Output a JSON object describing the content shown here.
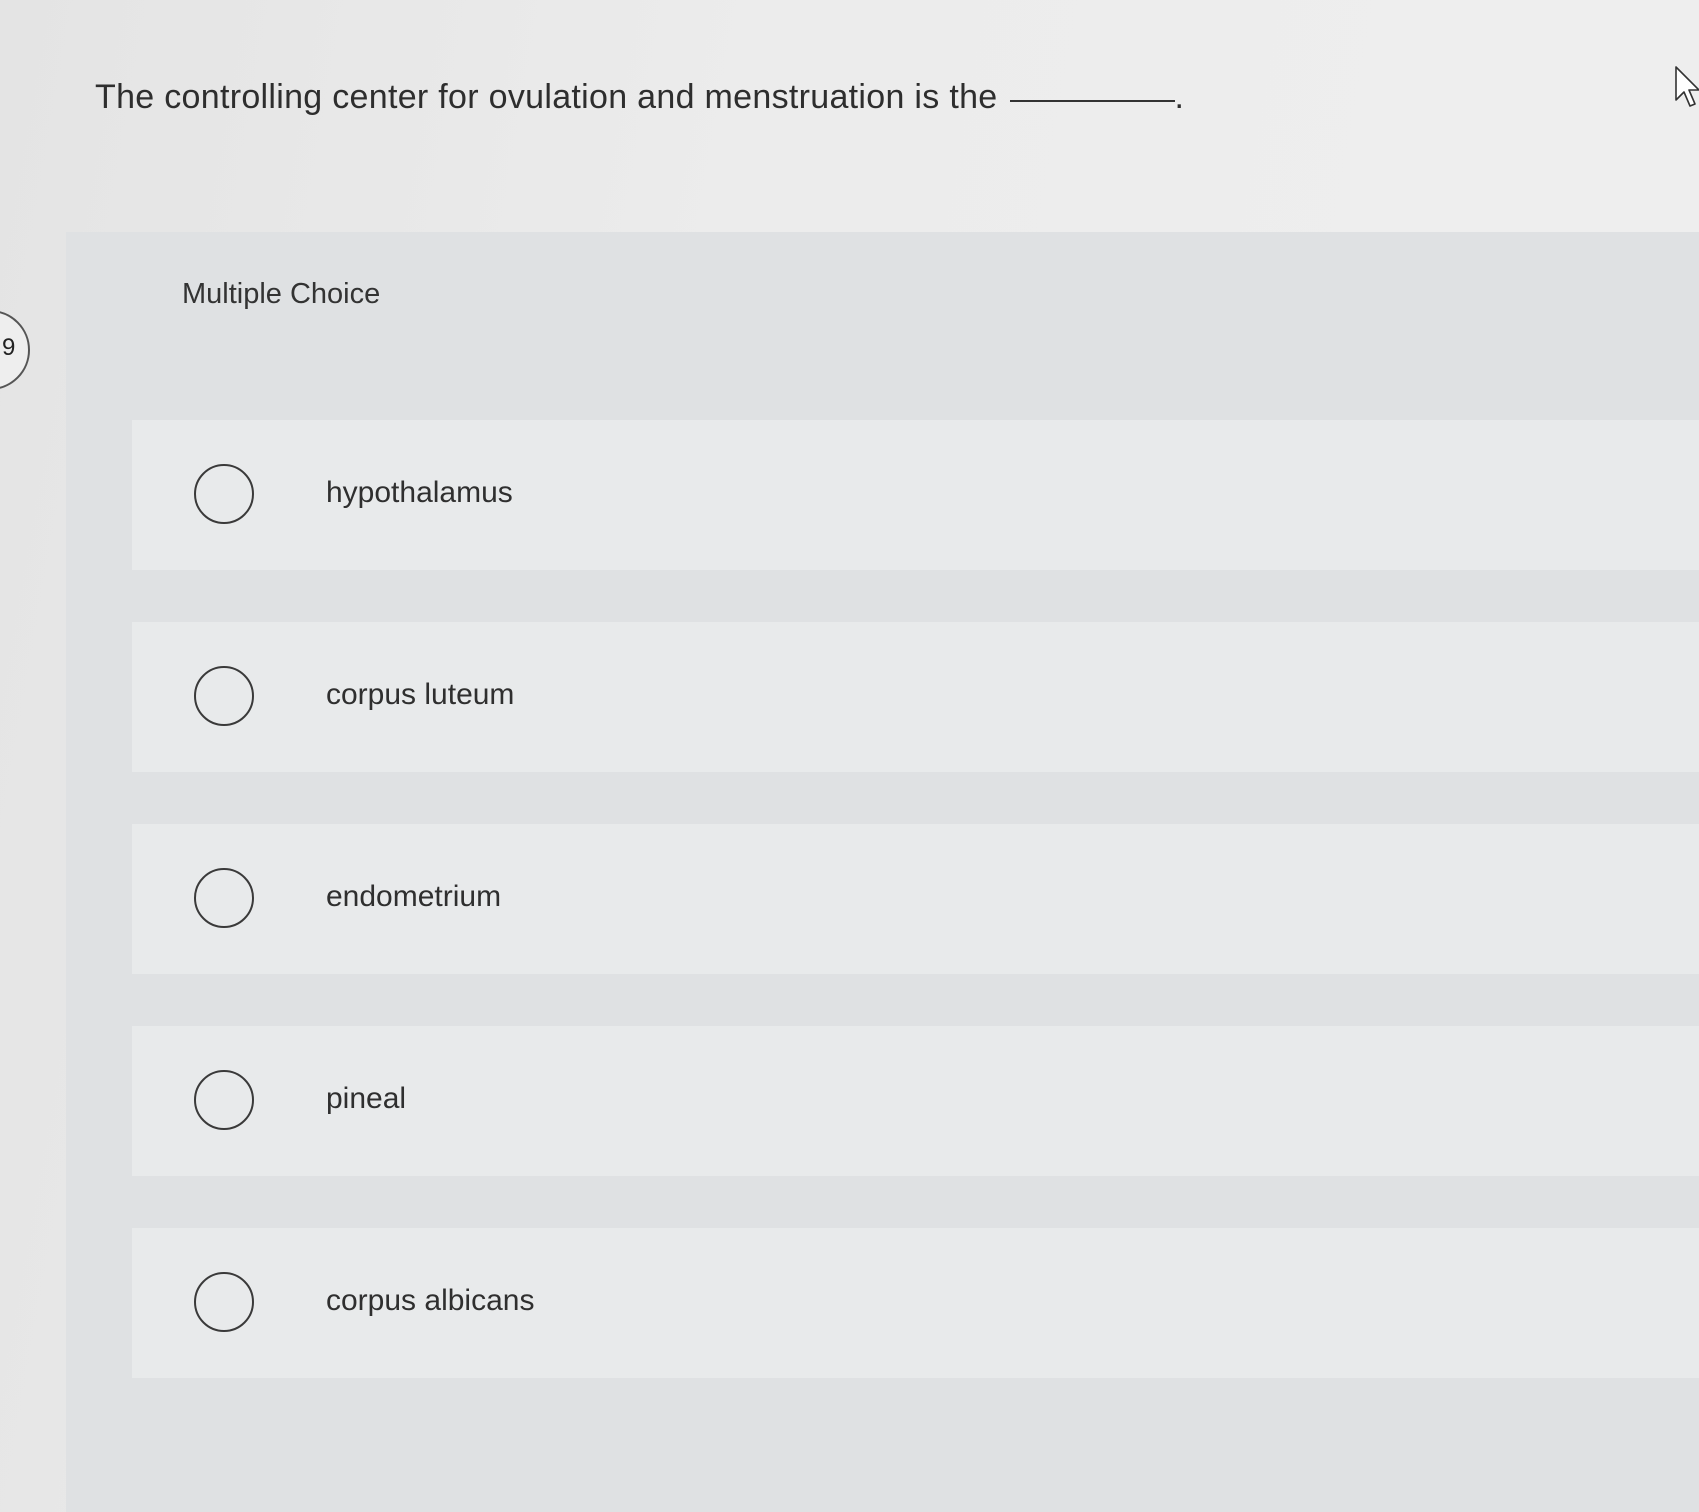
{
  "question": {
    "text": "The controlling center for ovulation and menstruation is the",
    "terminal_punctuation": "."
  },
  "side_badge": {
    "text": "9"
  },
  "panel": {
    "label": "Multiple Choice"
  },
  "options": [
    {
      "label": "hypothalamus",
      "selected": false
    },
    {
      "label": "corpus luteum",
      "selected": false
    },
    {
      "label": "endometrium",
      "selected": false
    },
    {
      "label": "pineal",
      "selected": false
    },
    {
      "label": "corpus albicans",
      "selected": false
    }
  ],
  "icons": {
    "cursor": "mouse-pointer-icon",
    "radio": "radio-button-icon"
  },
  "colors": {
    "page_background": "#ececec",
    "panel_background": "#dfe1e3",
    "option_background": "#e8eaeb",
    "text": "#2e2e2e"
  }
}
